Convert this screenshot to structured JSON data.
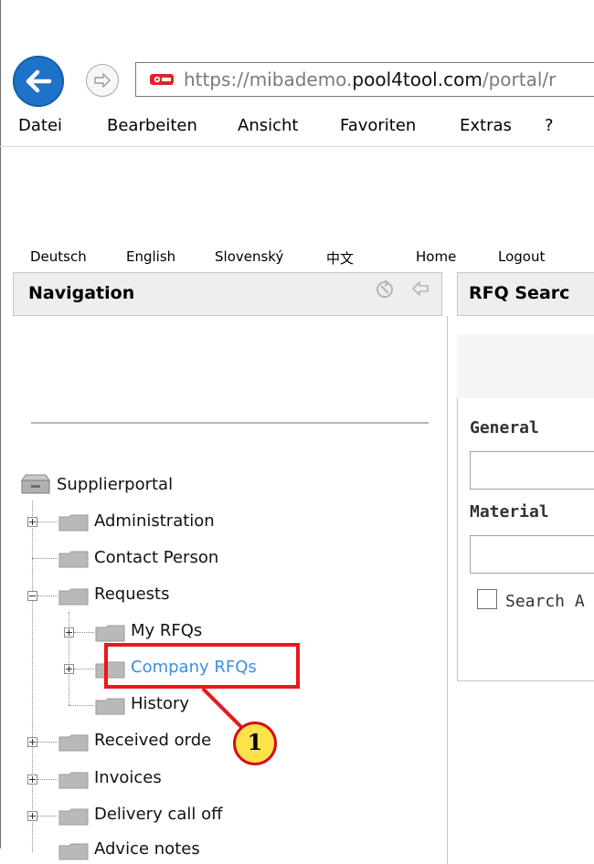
{
  "browser": {
    "url_prefix": "https://",
    "url_domain_sub": "mibademo.",
    "url_domain": "pool4tool.com",
    "url_path": "/portal/r",
    "menu": [
      "Datei",
      "Bearbeiten",
      "Ansicht",
      "Favoriten",
      "Extras",
      "?"
    ]
  },
  "top_links": {
    "languages": [
      "Deutsch",
      "English",
      "Slovenský",
      "中文"
    ],
    "home": "Home",
    "logout": "Logout"
  },
  "navigation": {
    "title": "Navigation",
    "tree": {
      "root": "Supplierportal",
      "items": [
        {
          "label": "Administration"
        },
        {
          "label": "Contact Person"
        },
        {
          "label": "Requests"
        },
        {
          "label": "My RFQs"
        },
        {
          "label": "Company RFQs"
        },
        {
          "label": "History"
        },
        {
          "label": "Received orde"
        },
        {
          "label": "Invoices"
        },
        {
          "label": "Delivery call off"
        },
        {
          "label": "Advice notes"
        }
      ]
    }
  },
  "rfq_search": {
    "title": "RFQ Searc",
    "general_label": "General",
    "material_label": "Material",
    "checkbox_label": "Search A"
  },
  "callout": {
    "number": "1"
  },
  "colors": {
    "highlight_border": "#e8181b",
    "callout_fill": "#fde24a",
    "selected_link": "#3a8ee6",
    "back_button": "#1e73c8"
  }
}
